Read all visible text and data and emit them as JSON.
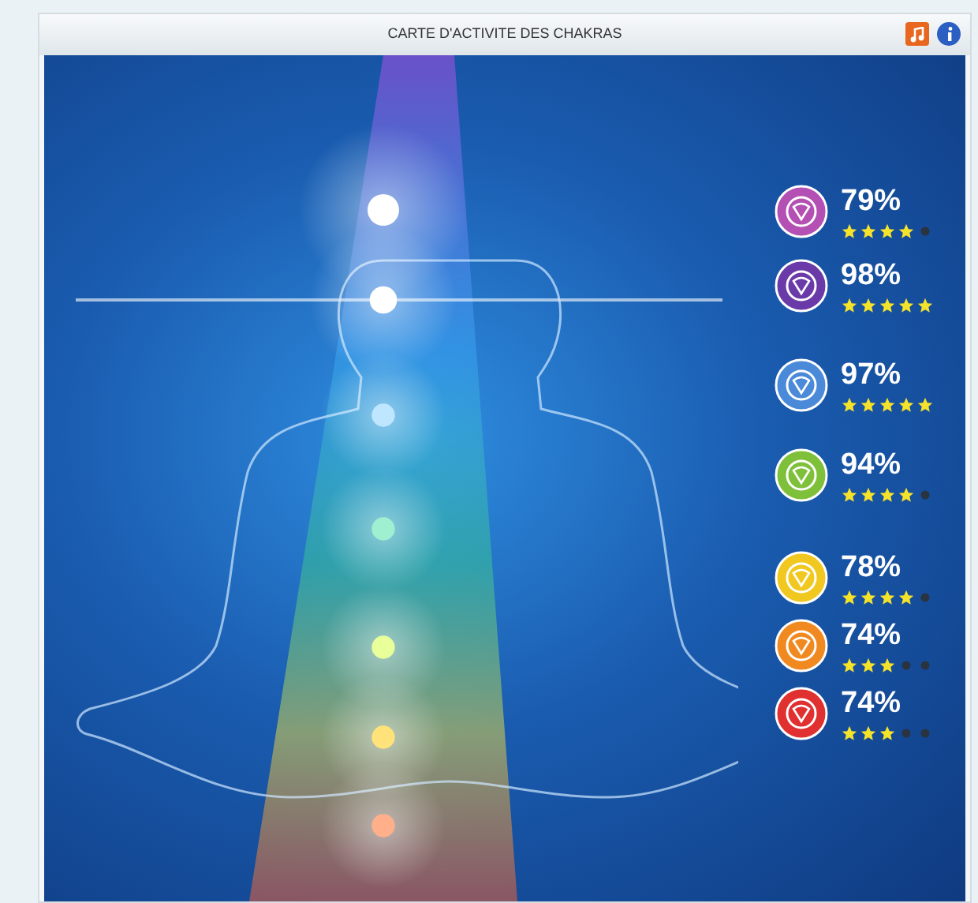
{
  "panel": {
    "title": "CARTE D'ACTIVITE DES CHAKRAS"
  },
  "chakras": [
    {
      "percent": "79%",
      "stars": 4,
      "color": "#b44fb4"
    },
    {
      "percent": "98%",
      "stars": 5,
      "color": "#6a3aa8"
    },
    {
      "percent": "97%",
      "stars": 5,
      "color": "#4a8ad8"
    },
    {
      "percent": "94%",
      "stars": 4,
      "color": "#7ec03a"
    },
    {
      "percent": "78%",
      "stars": 4,
      "color": "#f0c820"
    },
    {
      "percent": "74%",
      "stars": 3,
      "color": "#f08a20"
    },
    {
      "percent": "74%",
      "stars": 3,
      "color": "#e03030"
    }
  ]
}
